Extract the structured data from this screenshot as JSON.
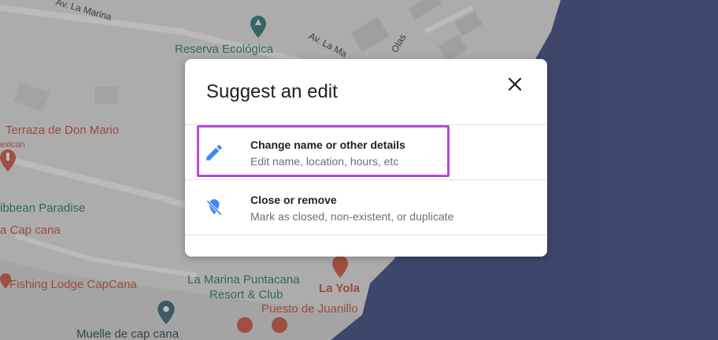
{
  "map": {
    "labels": {
      "av_la_marina_top": "Av. La Marina",
      "reserva": "Reserva Ecológica",
      "av_la_ma": "Av. La Ma",
      "olas": "Olas",
      "terraza": "Terraza de Don Mario",
      "exican": "exican",
      "caribbean": "ibbean Paradise",
      "cap_cana": "a Cap cana",
      "fishing": "Fishing Lodge CapCana",
      "la_marina_1": "La Marina Puntacana",
      "la_marina_2": "Resort & Club",
      "la_yola": "La Yola",
      "puesto": "Puesto de Juanillo",
      "muelle": "Muelle de cap cana"
    }
  },
  "dialog": {
    "title": "Suggest an edit",
    "options": [
      {
        "title": "Change name or other details",
        "subtitle": "Edit name, location, hours, etc",
        "icon": "pencil-icon",
        "highlighted": true
      },
      {
        "title": "Close or remove",
        "subtitle": "Mark as closed, non-existent, or duplicate",
        "icon": "location-off-icon",
        "highlighted": false
      }
    ]
  },
  "colors": {
    "accent_icon": "#4285f4",
    "highlight_border": "#b54cd6",
    "water": "#3f4e85",
    "land": "#e9e9e9"
  }
}
